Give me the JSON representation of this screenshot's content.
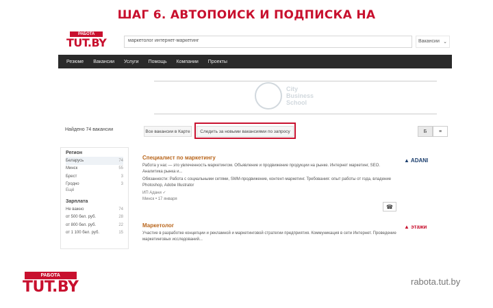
{
  "slide": {
    "title": "ШАГ 6. АВТОПОИСК И ПОДПИСКА НА",
    "footer_url": "rabota.tut.by",
    "logo_top": "РАБОТА",
    "logo_main": "TUT.BY"
  },
  "site": {
    "logo_top": "РАБОТА",
    "logo_main": "TUT.BY",
    "search_value": "маркетолог интернет-маркетинг",
    "vacancy_select": "Вакансии",
    "nav": [
      "Резюме",
      "Вакансии",
      "Услуги",
      "Помощь",
      "Компании",
      "Проекты"
    ],
    "banner": {
      "line1": "City",
      "line2": "Business",
      "line3": "School"
    },
    "found_label": "Найдено 74 вакансии",
    "save_button": "Все вакансии в Карте",
    "subscribe_button": "Следить за новыми вакансиями по запросу",
    "view_buttons": [
      "Б",
      "≡"
    ],
    "sidebar": {
      "region_heading": "Регион",
      "regions": [
        {
          "name": "Беларусь",
          "count": "74"
        },
        {
          "name": "Минск",
          "count": "55"
        },
        {
          "name": "Брест",
          "count": "3"
        },
        {
          "name": "Гродно",
          "count": "3"
        }
      ],
      "more": "Ещё",
      "salary_heading": "Зарплата",
      "salaries": [
        {
          "name": "Не важно",
          "count": "74"
        },
        {
          "name": "от 500 бел. руб.",
          "count": "28"
        },
        {
          "name": "от 800 бел. руб.",
          "count": "22"
        },
        {
          "name": "от 1 100 бел. руб.",
          "count": "15"
        }
      ]
    },
    "vacancies": [
      {
        "title": "Специалист по маркетингу",
        "desc": "Работа у нас — это увлеченность маркетингом. Объявление и продвижение продукции на рынке. Интернет маркетинг, SEO. Аналитика рынка и...",
        "desc2": "Обязанности: Работа с социальными сетями, SMM-продвижение, контент-маркетинг. Требования: опыт работы от года, владение Photoshop, Adobe Illustrator",
        "meta1": "ИП Адани ✓",
        "meta2": "Минск • 17 января",
        "company": "ADANI"
      },
      {
        "title": "Маркетолог",
        "desc": "Участие в разработке концепции и рекламной и маркетинговой стратегии предприятия. Коммуникация в сети Интернет. Проведение маркетинговых исследований...",
        "company": "этажи"
      }
    ]
  }
}
